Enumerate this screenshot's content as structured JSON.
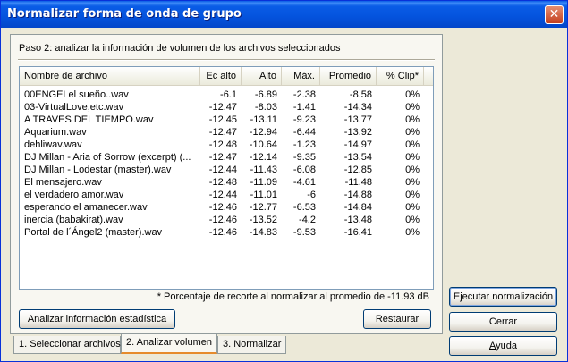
{
  "window": {
    "title": "Normalizar forma de onda de grupo"
  },
  "step": {
    "title": "Paso 2: analizar la información de volumen de los archivos seleccionados"
  },
  "list": {
    "columns": [
      "Nombre de archivo",
      "Ec alto",
      "Alto",
      "Máx.",
      "Promedio",
      "% Clip*"
    ],
    "rows": [
      [
        "00ENGELel sueño..wav",
        "-6.1",
        "-6.89",
        "-2.38",
        "-8.58",
        "0%"
      ],
      [
        "03-VirtualLove,etc.wav",
        "-12.47",
        "-8.03",
        "-1.41",
        "-14.34",
        "0%"
      ],
      [
        "A TRAVES DEL TIEMPO.wav",
        "-12.45",
        "-13.11",
        "-9.23",
        "-13.77",
        "0%"
      ],
      [
        "Aquarium.wav",
        "-12.47",
        "-12.94",
        "-6.44",
        "-13.92",
        "0%"
      ],
      [
        "dehliwav.wav",
        "-12.48",
        "-10.64",
        "-1.23",
        "-14.97",
        "0%"
      ],
      [
        "DJ Millan - Aria of Sorrow (excerpt) (...",
        "-12.47",
        "-12.14",
        "-9.35",
        "-13.54",
        "0%"
      ],
      [
        "DJ Millan - Lodestar (master).wav",
        "-12.44",
        "-11.43",
        "-6.08",
        "-12.85",
        "0%"
      ],
      [
        "El mensajero.wav",
        "-12.48",
        "-11.09",
        "-4.61",
        "-11.48",
        "0%"
      ],
      [
        "el verdadero amor.wav",
        "-12.44",
        "-11.01",
        "-6",
        "-14.88",
        "0%"
      ],
      [
        "esperando el amanecer.wav",
        "-12.46",
        "-12.77",
        "-6.53",
        "-14.84",
        "0%"
      ],
      [
        "inercia (babakirat).wav",
        "-12.46",
        "-13.52",
        "-4.2",
        "-13.48",
        "0%"
      ],
      [
        "Portal de l´Ángel2 (master).wav",
        "-12.46",
        "-14.83",
        "-9.53",
        "-16.41",
        "0%"
      ]
    ]
  },
  "footnote": "* Porcentaje de recorte al normalizar al promedio de -11.93 dB",
  "buttons": {
    "analyze_stats": "Analizar información estadística",
    "restore": "Restaurar",
    "run_normalize": "Ejecutar normalización",
    "close": "Cerrar",
    "help_prefix": "",
    "help_underline": "A",
    "help_rest": "yuda"
  },
  "tabs": [
    "1. Seleccionar archivos",
    "2. Analizar volumen",
    "3. Normalizar"
  ],
  "icons": {
    "close": "close-icon"
  }
}
